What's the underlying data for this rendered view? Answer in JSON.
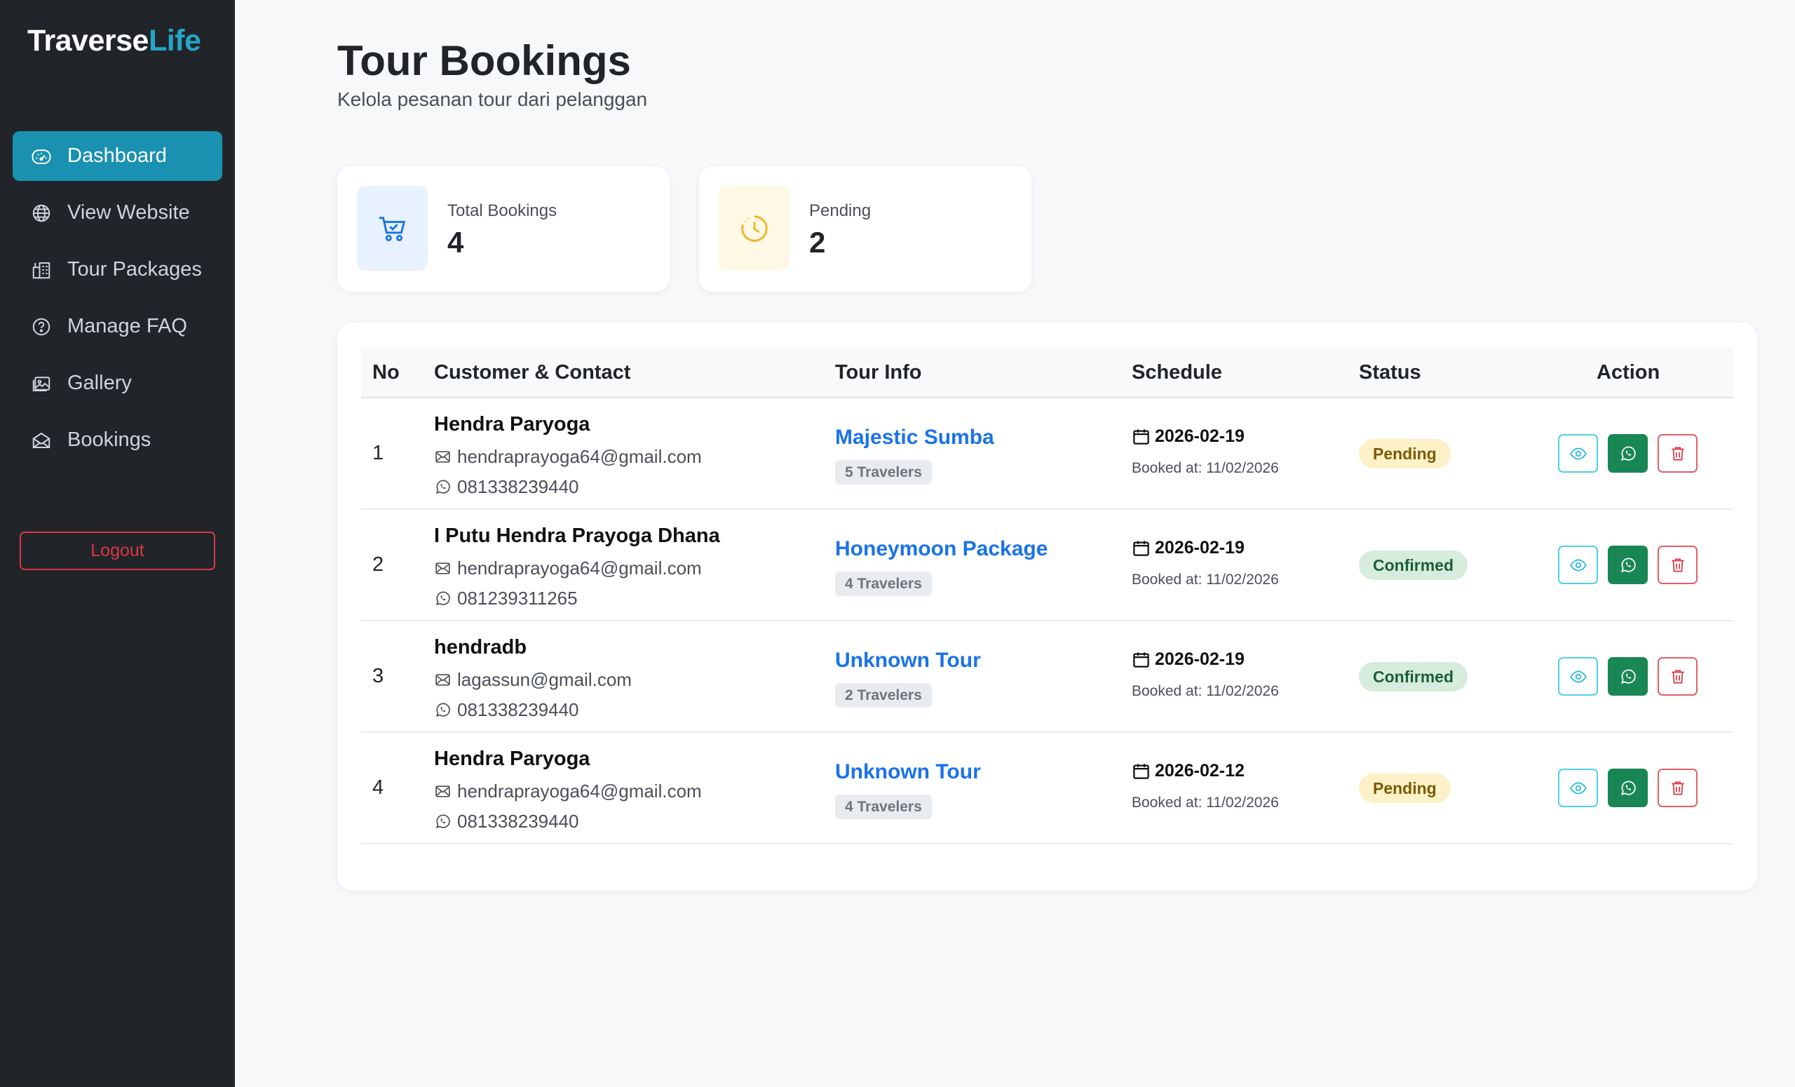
{
  "brand": {
    "name_main": "Traverse",
    "name_accent": "Life"
  },
  "sidebar": {
    "items": [
      {
        "label": "Dashboard",
        "icon": "speedometer-icon",
        "active": true
      },
      {
        "label": "View Website",
        "icon": "globe-icon",
        "active": false
      },
      {
        "label": "Tour Packages",
        "icon": "buildings-icon",
        "active": false
      },
      {
        "label": "Manage FAQ",
        "icon": "question-circle-icon",
        "active": false
      },
      {
        "label": "Gallery",
        "icon": "images-icon",
        "active": false
      },
      {
        "label": "Bookings",
        "icon": "envelope-open-icon",
        "active": false
      }
    ],
    "logout_label": "Logout"
  },
  "header": {
    "title": "Tour Bookings",
    "subtitle": "Kelola pesanan tour dari pelanggan"
  },
  "stats": {
    "total": {
      "label": "Total Bookings",
      "value": "4",
      "icon": "cart-check-icon",
      "color": "#e7f1ff"
    },
    "pending": {
      "label": "Pending",
      "value": "2",
      "icon": "clock-icon",
      "color": "#fff8e5"
    }
  },
  "table": {
    "headers": {
      "no": "No",
      "customer": "Customer & Contact",
      "tour": "Tour Info",
      "schedule": "Schedule",
      "status": "Status",
      "action": "Action"
    },
    "rows": [
      {
        "no": "1",
        "name": "Hendra Paryoga",
        "email": "hendraprayoga64@gmail.com",
        "phone": "081338239440",
        "tour": "Majestic Sumba",
        "travelers": "5 Travelers",
        "date": "2026-02-19",
        "booked": "Booked at: 11/02/2026",
        "status": "Pending"
      },
      {
        "no": "2",
        "name": "I Putu Hendra Prayoga Dhana",
        "email": "hendraprayoga64@gmail.com",
        "phone": "081239311265",
        "tour": "Honeymoon Package",
        "travelers": "4 Travelers",
        "date": "2026-02-19",
        "booked": "Booked at: 11/02/2026",
        "status": "Confirmed"
      },
      {
        "no": "3",
        "name": "hendradb",
        "email": "lagassun@gmail.com",
        "phone": "081338239440",
        "tour": "Unknown Tour",
        "travelers": "2 Travelers",
        "date": "2026-02-19",
        "booked": "Booked at: 11/02/2026",
        "status": "Confirmed"
      },
      {
        "no": "4",
        "name": "Hendra Paryoga",
        "email": "hendraprayoga64@gmail.com",
        "phone": "081338239440",
        "tour": "Unknown Tour",
        "travelers": "4 Travelers",
        "date": "2026-02-12",
        "booked": "Booked at: 11/02/2026",
        "status": "Pending"
      }
    ]
  },
  "colors": {
    "sidebar_bg": "#212529",
    "accent": "#1a91b0",
    "link": "#1a73e8",
    "pending_bg": "#fdf1c7",
    "confirmed_bg": "#d6ecdc",
    "whatsapp": "#198754",
    "danger": "#dc3545"
  }
}
